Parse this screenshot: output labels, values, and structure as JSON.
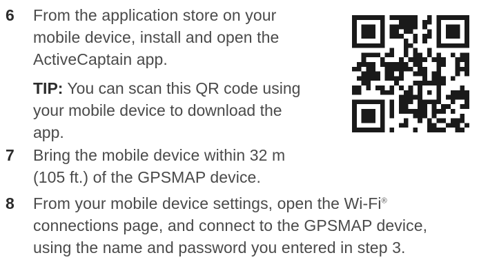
{
  "steps": [
    {
      "number": "6",
      "lines": [
        "From the application store on your",
        "mobile device, install and open the",
        "ActiveCaptain app."
      ]
    },
    {
      "number": "7",
      "lines": [
        "Bring the mobile device within 32 m",
        "(105 ft.) of the GPSMAP device."
      ]
    },
    {
      "number": "8",
      "line1_before": "From your mobile device settings, open the Wi-Fi",
      "line1_mark": "®",
      "lines_rest": [
        "connections page, and connect to the GPSMAP device,",
        "using the name and password you entered in step 3."
      ]
    }
  ],
  "tip": {
    "label": "TIP:",
    "line1_rest": " You can scan this QR code using",
    "lines_rest": [
      "your mobile device to download the",
      "app."
    ]
  },
  "qr_code": {
    "icon": "qr-code-icon",
    "color": "#1a1a1a"
  }
}
